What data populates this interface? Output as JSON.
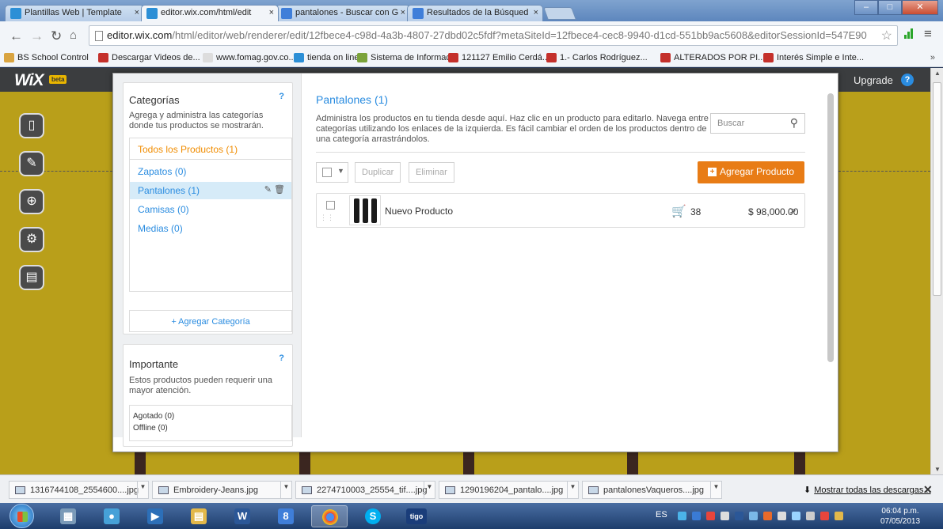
{
  "browser": {
    "tabs": [
      {
        "label": "Plantillas Web | Template",
        "icon": "wix-favicon"
      },
      {
        "label": "editor.wix.com/html/edit",
        "icon": "wix-favicon",
        "active": true
      },
      {
        "label": "pantalones - Buscar con G",
        "icon": "google-favicon"
      },
      {
        "label": "Resultados de la Búsqued",
        "icon": "google-favicon"
      }
    ],
    "tab_close": "×",
    "url_host": "editor.wix.com",
    "url_path": "/html/editor/web/renderer/edit/12fbece4-c98d-4a3b-4807-27dbd02c5fdf?metaSiteId=12fbece4-cec8-9940-d1cd-551bb9ac5608&editorSessionId=547E90",
    "bookmarks": [
      "BS School Control",
      "Descargar Videos de...",
      "www.fomag.gov.co...",
      "tienda on line",
      "Sistema de Informac...",
      "121127 Emilio Cerdá...",
      "1.- Carlos Rodríguez...",
      "ALTERADOS POR PI...",
      "Interés Simple e Inte..."
    ],
    "bookmarks_more": "»"
  },
  "wix": {
    "logo": "WiX",
    "beta": "beta",
    "upgrade": "Upgrade",
    "help": "?"
  },
  "categories": {
    "title": "Categorías",
    "help": "?",
    "description": "Agrega y administra las categorías donde tus productos se mostrarán.",
    "all_label": "Todos los Productos (1)",
    "items": [
      {
        "label": "Zapatos (0)"
      },
      {
        "label": "Pantalones (1)",
        "selected": true
      },
      {
        "label": "Camisas (0)"
      },
      {
        "label": "Medias (0)"
      }
    ],
    "add_label": "+ Agregar Categoría"
  },
  "important": {
    "title": "Importante",
    "help": "?",
    "description": "Estos productos pueden requerir una mayor atención.",
    "items": [
      "Agotado (0)",
      "Offline (0)"
    ]
  },
  "products": {
    "title": "Pantalones (1)",
    "description": "Administra los productos en tu tienda desde aquí. Haz clic en un producto para editarlo. Navega entre categorías utilizando los enlaces de la izquierda. Es fácil cambiar el orden de los productos dentro de una categoría arrastrándolos.",
    "search_placeholder": "Buscar",
    "duplicate_label": "Duplicar",
    "delete_label": "Eliminar",
    "add_label": "Agregar Producto",
    "list": [
      {
        "name": "Nuevo Producto",
        "stock": "38",
        "price": "$ 98,000.00"
      }
    ]
  },
  "downloads": {
    "items": [
      "1316744108_2554600....jpg",
      "Embroidery-Jeans.jpg",
      "2274710003_25554_tif....jpg",
      "1290196204_pantalo....jpg",
      "pantalonesVaqueros....jpg"
    ],
    "show_all": "Mostrar todas las descargas..."
  },
  "taskbar": {
    "language": "ES",
    "time": "06:04 p.m.",
    "date": "07/05/2013",
    "apps": [
      "ie",
      "calculator",
      "outlook",
      "media",
      "explorer",
      "word",
      "google",
      "chrome",
      "skype",
      "tigo"
    ]
  },
  "colors": {
    "accent": "#2a8ce0",
    "orange": "#e87c16",
    "editor_bg": "#b99f1a"
  }
}
